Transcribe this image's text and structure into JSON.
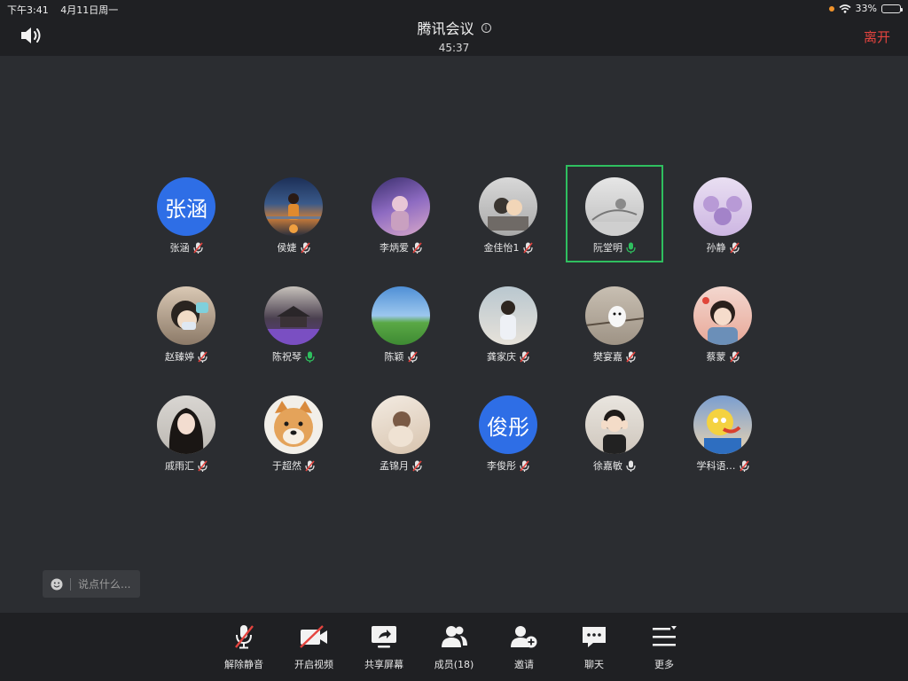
{
  "status_bar": {
    "time": "下午3:41",
    "date": "4月11日周一",
    "battery": "33%",
    "battery_level": 0.33
  },
  "header": {
    "title": "腾讯会议",
    "timer": "45:37",
    "leave_label": "离开"
  },
  "participants": [
    {
      "name": "张涵",
      "avatar_text": "张涵",
      "mic": "muted"
    },
    {
      "name": "侯婕",
      "mic": "muted"
    },
    {
      "name": "李炳爱",
      "mic": "muted"
    },
    {
      "name": "金佳怡1",
      "mic": "muted"
    },
    {
      "name": "阮堂明",
      "mic": "speaking"
    },
    {
      "name": "孙静",
      "mic": "muted"
    },
    {
      "name": "赵臻婷",
      "mic": "muted"
    },
    {
      "name": "陈祝琴",
      "mic": "speaking"
    },
    {
      "name": "陈颖",
      "mic": "muted"
    },
    {
      "name": "龚家庆",
      "mic": "muted"
    },
    {
      "name": "樊宴嘉",
      "mic": "muted"
    },
    {
      "name": "蔡蒙",
      "mic": "muted"
    },
    {
      "name": "戚雨汇",
      "mic": "muted"
    },
    {
      "name": "于超然",
      "mic": "muted"
    },
    {
      "name": "孟锦月",
      "mic": "muted"
    },
    {
      "name": "李俊彤",
      "avatar_text": "俊彤",
      "mic": "muted"
    },
    {
      "name": "徐嘉敏",
      "mic": "on"
    },
    {
      "name": "学科语…",
      "mic": "muted"
    }
  ],
  "chat": {
    "placeholder": "说点什么..."
  },
  "toolbar": {
    "unmute_label": "解除静音",
    "video_label": "开启视频",
    "share_label": "共享屏幕",
    "members_label": "成员(18)",
    "invite_label": "邀请",
    "chat_label": "聊天",
    "more_label": "更多"
  },
  "colors": {
    "accent_blue": "#2e6ee6",
    "speaking_green": "#2fbf5f",
    "muted_red": "#e5443f",
    "leave_red": "#e5443f",
    "background": "#2b2d31",
    "bar": "#1f2023"
  }
}
